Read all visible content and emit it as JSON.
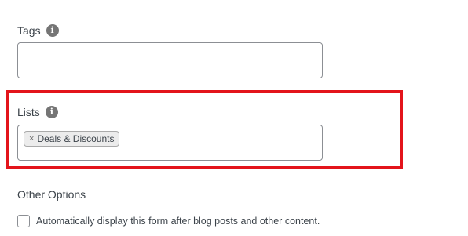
{
  "tags": {
    "label": "Tags",
    "info_icon": "info-icon",
    "value": ""
  },
  "lists": {
    "label": "Lists",
    "info_icon": "info-icon",
    "selected": [
      {
        "remove_glyph": "×",
        "label": "Deals & Discounts"
      }
    ],
    "highlight_color": "#e3141b"
  },
  "other_options": {
    "heading": "Other Options",
    "auto_display": {
      "checked": false,
      "label": "Automatically display this form after blog posts and other content."
    }
  }
}
